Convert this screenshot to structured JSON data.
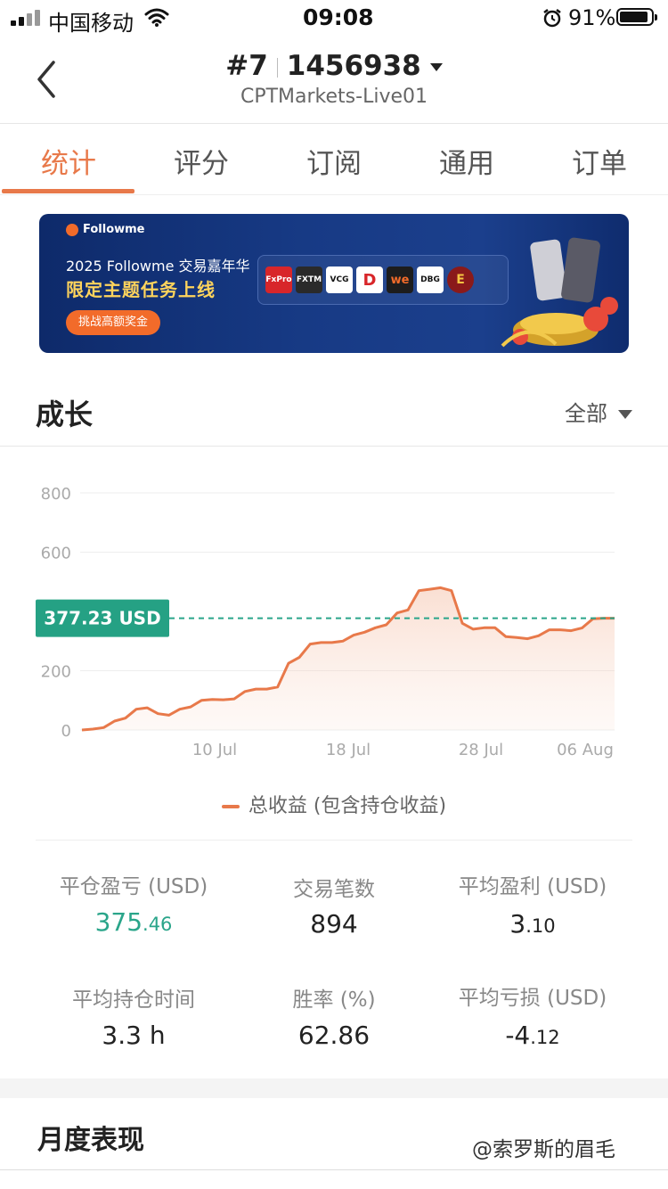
{
  "status_bar": {
    "carrier": "中国移动",
    "time": "09:08",
    "battery": "91%"
  },
  "header": {
    "rank": "#7",
    "account": "1456938",
    "server": "CPTMarkets-Live01"
  },
  "tabs": [
    "统计",
    "评分",
    "订阅",
    "通用",
    "订单"
  ],
  "banner": {
    "brand": "Followme",
    "line1": "2025 Followme 交易嘉年华",
    "line2": "限定主题任务上线",
    "button": "挑战高额奖金",
    "partners": [
      "FxPro",
      "FXTM",
      "VCG",
      "D",
      "we",
      "DBG",
      "E"
    ]
  },
  "growth": {
    "title": "成长",
    "filter": "全部"
  },
  "chart_data": {
    "type": "area",
    "y_ticks": [
      "800",
      "600",
      "200",
      "0"
    ],
    "x_ticks": [
      "10 Jul",
      "18 Jul",
      "28 Jul",
      "06 Aug"
    ],
    "current_label": "377.23 USD",
    "current_value": 377.23,
    "series": [
      {
        "name": "总收益 (包含持仓收益)",
        "color": "#e8794a",
        "values": [
          0,
          3,
          8,
          30,
          40,
          70,
          75,
          55,
          50,
          70,
          78,
          100,
          103,
          102,
          105,
          130,
          138,
          138,
          145,
          225,
          245,
          290,
          295,
          295,
          300,
          320,
          330,
          345,
          355,
          395,
          405,
          470,
          475,
          480,
          470,
          360,
          340,
          345,
          345,
          315,
          312,
          308,
          318,
          338,
          338,
          335,
          344,
          375,
          377.23,
          377.23
        ]
      }
    ]
  },
  "stats": [
    {
      "label": "平仓盈亏 (USD)",
      "int": "375",
      "dec": ".46"
    },
    {
      "label": "交易笔数",
      "int": "894",
      "dec": ""
    },
    {
      "label": "平均盈利 (USD)",
      "int": "3",
      "dec": ".10"
    },
    {
      "label": "平均持仓时间",
      "int": "3.3 h",
      "dec": ""
    },
    {
      "label": "胜率 (%)",
      "int": "62.86",
      "dec": ""
    },
    {
      "label": "平均亏损 (USD)",
      "int": "-4",
      "dec": ".12"
    }
  ],
  "monthly": {
    "title": "月度表现"
  },
  "watermark": "@索罗斯的眉毛"
}
